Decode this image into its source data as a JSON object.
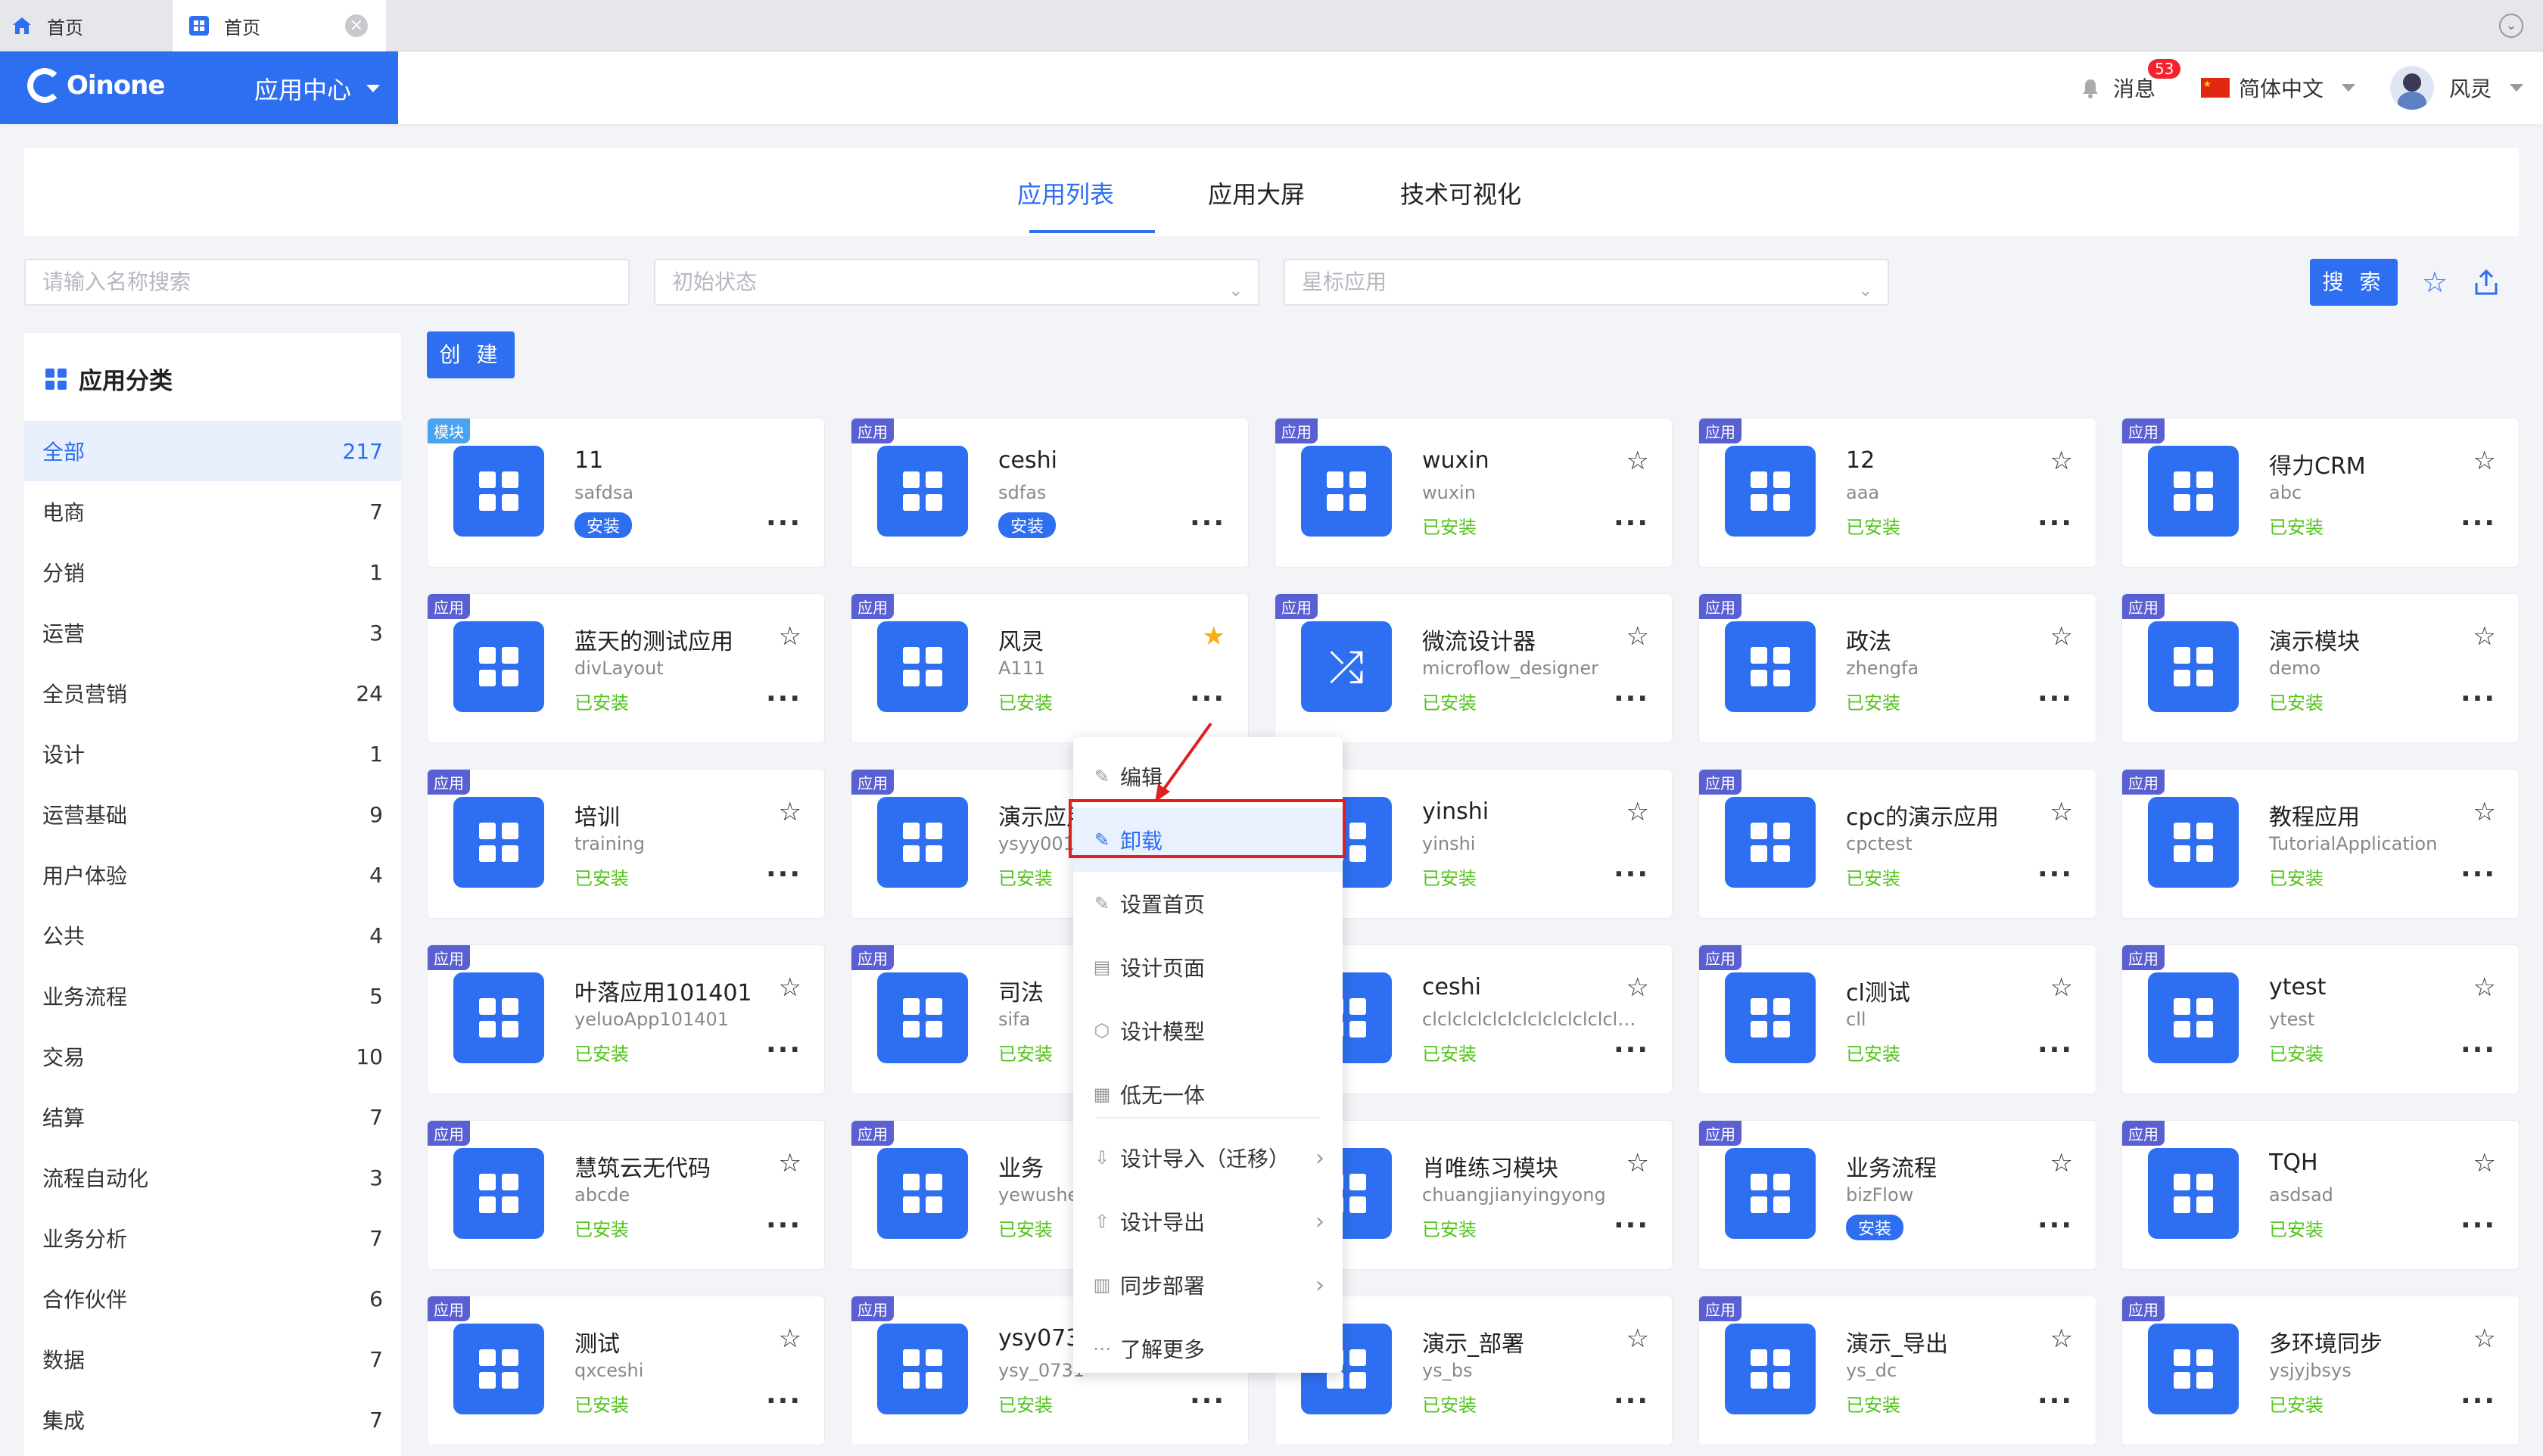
{
  "browser_tabs": [
    {
      "label": "首页"
    },
    {
      "label": "首页"
    }
  ],
  "header": {
    "brand": "Oinone",
    "app_center": "应用中心",
    "messages_label": "消息",
    "messages_count": "53",
    "language": "简体中文",
    "user_name": "风灵"
  },
  "nav": {
    "tabs": [
      {
        "label": "应用列表"
      },
      {
        "label": "应用大屏"
      },
      {
        "label": "技术可视化"
      }
    ]
  },
  "filters": {
    "search_placeholder": "请输入名称搜索",
    "status_placeholder": "初始状态",
    "star_placeholder": "星标应用",
    "search_button": "搜 索"
  },
  "sidebar": {
    "title": "应用分类",
    "items": [
      {
        "label": "全部",
        "count": "217"
      },
      {
        "label": "电商",
        "count": "7"
      },
      {
        "label": "分销",
        "count": "1"
      },
      {
        "label": "运营",
        "count": "3"
      },
      {
        "label": "全员营销",
        "count": "24"
      },
      {
        "label": "设计",
        "count": "1"
      },
      {
        "label": "运营基础",
        "count": "9"
      },
      {
        "label": "用户体验",
        "count": "4"
      },
      {
        "label": "公共",
        "count": "4"
      },
      {
        "label": "业务流程",
        "count": "5"
      },
      {
        "label": "交易",
        "count": "10"
      },
      {
        "label": "结算",
        "count": "7"
      },
      {
        "label": "流程自动化",
        "count": "3"
      },
      {
        "label": "业务分析",
        "count": "7"
      },
      {
        "label": "合作伙伴",
        "count": "6"
      },
      {
        "label": "数据",
        "count": "7"
      },
      {
        "label": "集成",
        "count": "7"
      }
    ]
  },
  "create_button": "创 建",
  "cards": [
    {
      "tag": "模块",
      "name": "11",
      "code": "safdsa",
      "status": "安装"
    },
    {
      "tag": "应用",
      "name": "ceshi",
      "code": "sdfas",
      "status": "安装"
    },
    {
      "tag": "应用",
      "name": "wuxin",
      "code": "wuxin",
      "status": "已安装"
    },
    {
      "tag": "应用",
      "name": "12",
      "code": "aaa",
      "status": "已安装"
    },
    {
      "tag": "应用",
      "name": "得力CRM",
      "code": "abc",
      "status": "已安装"
    },
    {
      "tag": "应用",
      "name": "蓝天的测试应用",
      "code": "divLayout",
      "status": "已安装"
    },
    {
      "tag": "应用",
      "name": "风灵",
      "code": "A111",
      "status": "已安装"
    },
    {
      "tag": "应用",
      "name": "微流设计器",
      "code": "microflow_designer",
      "status": "已安装"
    },
    {
      "tag": "应用",
      "name": "政法",
      "code": "zhengfa",
      "status": "已安装"
    },
    {
      "tag": "应用",
      "name": "演示模块",
      "code": "demo",
      "status": "已安装"
    },
    {
      "tag": "应用",
      "name": "培训",
      "code": "training",
      "status": "已安装"
    },
    {
      "tag": "应用",
      "name": "演示应用",
      "code": "ysyy001",
      "status": "已安装"
    },
    {
      "tag": "应用",
      "name": "yinshi",
      "code": "yinshi",
      "status": "已安装"
    },
    {
      "tag": "应用",
      "name": "cpc的演示应用",
      "code": "cpctest",
      "status": "已安装"
    },
    {
      "tag": "应用",
      "name": "教程应用",
      "code": "TutorialApplication",
      "status": "已安装"
    },
    {
      "tag": "应用",
      "name": "叶落应用101401",
      "code": "yeluoApp101401",
      "status": "已安装"
    },
    {
      "tag": "应用",
      "name": "司法",
      "code": "sifa",
      "status": "已安装"
    },
    {
      "tag": "应用",
      "name": "ceshi",
      "code": "clclclclclclclclclclclclclcl...",
      "status": "已安装"
    },
    {
      "tag": "应用",
      "name": "cl测试",
      "code": "cll",
      "status": "已安装"
    },
    {
      "tag": "应用",
      "name": "ytest",
      "code": "ytest",
      "status": "已安装"
    },
    {
      "tag": "应用",
      "name": "慧筑云无代码",
      "code": "abcde",
      "status": "已安装"
    },
    {
      "tag": "应用",
      "name": "业务",
      "code": "yewushe",
      "status": "已安装"
    },
    {
      "tag": "应用",
      "name": "肖唯练习模块",
      "code": "chuangjianyingyong",
      "status": "已安装"
    },
    {
      "tag": "应用",
      "name": "业务流程",
      "code": "bizFlow",
      "status": "安装"
    },
    {
      "tag": "应用",
      "name": "TQH",
      "code": "asdsad",
      "status": "已安装"
    },
    {
      "tag": "应用",
      "name": "测试",
      "code": "qxceshi",
      "status": "已安装"
    },
    {
      "tag": "应用",
      "name": "ysy0731",
      "code": "ysy_0731",
      "status": "已安装"
    },
    {
      "tag": "应用",
      "name": "演示_部署",
      "code": "ys_bs",
      "status": "已安装"
    },
    {
      "tag": "应用",
      "name": "演示_导出",
      "code": "ys_dc",
      "status": "已安装"
    },
    {
      "tag": "应用",
      "name": "多环境同步",
      "code": "ysjyjbsys",
      "status": "已安装"
    }
  ],
  "context_menu": [
    {
      "label": "编辑"
    },
    {
      "label": "卸载"
    },
    {
      "label": "设置首页"
    },
    {
      "label": "设计页面"
    },
    {
      "label": "设计模型"
    },
    {
      "label": "低无一体"
    },
    {
      "label": "设计导入（迁移）"
    },
    {
      "label": "设计导出"
    },
    {
      "label": "同步部署"
    },
    {
      "label": "了解更多"
    }
  ],
  "colors": {
    "primary": "#2e6ef0",
    "installed": "#52c41a",
    "highlight": "#e02020",
    "star_active": "#faad14"
  }
}
